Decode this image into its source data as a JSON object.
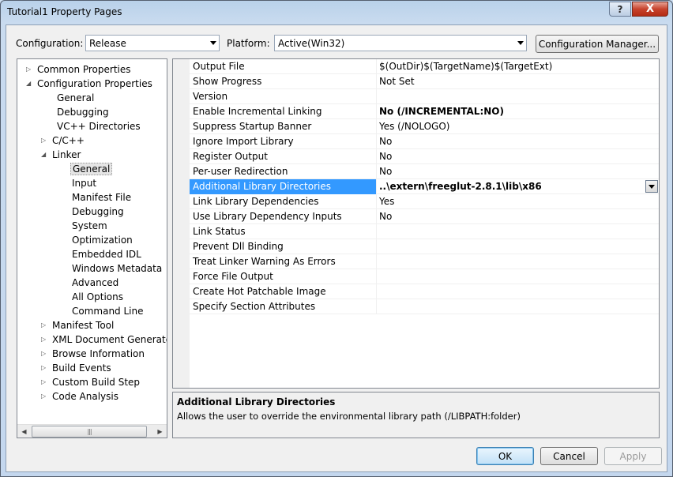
{
  "window": {
    "title": "Tutorial1 Property Pages",
    "help_glyph": "?",
    "close_glyph": "X"
  },
  "toolbar": {
    "configuration_label": "Configuration:",
    "configuration_value": "Release",
    "platform_label": "Platform:",
    "platform_value": "Active(Win32)",
    "config_manager_label": "Configuration Manager..."
  },
  "tree": {
    "items": [
      {
        "label": "Common Properties",
        "expander": "▷"
      },
      {
        "label": "Configuration Properties",
        "expander": "◢"
      },
      {
        "label": "General",
        "expander": ""
      },
      {
        "label": "Debugging",
        "expander": ""
      },
      {
        "label": "VC++ Directories",
        "expander": ""
      },
      {
        "label": "C/C++",
        "expander": "▷"
      },
      {
        "label": "Linker",
        "expander": "◢"
      },
      {
        "label": "General",
        "expander": "",
        "selected": true
      },
      {
        "label": "Input",
        "expander": ""
      },
      {
        "label": "Manifest File",
        "expander": ""
      },
      {
        "label": "Debugging",
        "expander": ""
      },
      {
        "label": "System",
        "expander": ""
      },
      {
        "label": "Optimization",
        "expander": ""
      },
      {
        "label": "Embedded IDL",
        "expander": ""
      },
      {
        "label": "Windows Metadata",
        "expander": ""
      },
      {
        "label": "Advanced",
        "expander": ""
      },
      {
        "label": "All Options",
        "expander": ""
      },
      {
        "label": "Command Line",
        "expander": ""
      },
      {
        "label": "Manifest Tool",
        "expander": "▷"
      },
      {
        "label": "XML Document Generator",
        "expander": "▷"
      },
      {
        "label": "Browse Information",
        "expander": "▷"
      },
      {
        "label": "Build Events",
        "expander": "▷"
      },
      {
        "label": "Custom Build Step",
        "expander": "▷"
      },
      {
        "label": "Code Analysis",
        "expander": "▷"
      }
    ],
    "scroll_left_glyph": "◀",
    "scroll_right_glyph": "▶",
    "scroll_thumb_grip": "|||"
  },
  "grid": {
    "rows": [
      {
        "name": "Output File",
        "value": "$(OutDir)$(TargetName)$(TargetExt)"
      },
      {
        "name": "Show Progress",
        "value": "Not Set"
      },
      {
        "name": "Version",
        "value": ""
      },
      {
        "name": "Enable Incremental Linking",
        "value": "No (/INCREMENTAL:NO)",
        "bold": true
      },
      {
        "name": "Suppress Startup Banner",
        "value": "Yes (/NOLOGO)"
      },
      {
        "name": "Ignore Import Library",
        "value": "No"
      },
      {
        "name": "Register Output",
        "value": "No"
      },
      {
        "name": "Per-user Redirection",
        "value": "No"
      },
      {
        "name": "Additional Library Directories",
        "value": "..\\extern\\freeglut-2.8.1\\lib\\x86",
        "bold": true,
        "selected": true
      },
      {
        "name": "Link Library Dependencies",
        "value": "Yes"
      },
      {
        "name": "Use Library Dependency Inputs",
        "value": "No"
      },
      {
        "name": "Link Status",
        "value": ""
      },
      {
        "name": "Prevent Dll Binding",
        "value": ""
      },
      {
        "name": "Treat Linker Warning As Errors",
        "value": ""
      },
      {
        "name": "Force File Output",
        "value": ""
      },
      {
        "name": "Create Hot Patchable Image",
        "value": ""
      },
      {
        "name": "Specify Section Attributes",
        "value": ""
      }
    ]
  },
  "description": {
    "title": "Additional Library Directories",
    "text": "Allows the user to override the environmental library path (/LIBPATH:folder)"
  },
  "buttons": {
    "ok": "OK",
    "cancel": "Cancel",
    "apply": "Apply"
  }
}
